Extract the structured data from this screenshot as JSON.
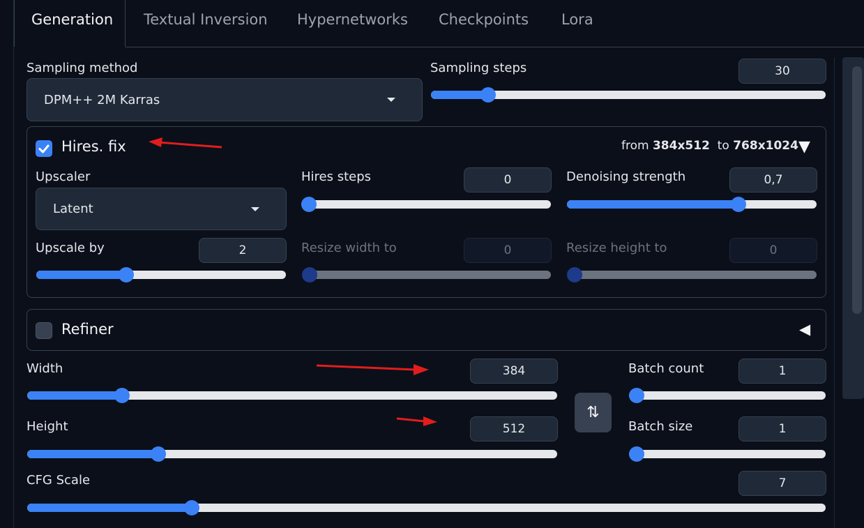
{
  "tabs": [
    "Generation",
    "Textual Inversion",
    "Hypernetworks",
    "Checkpoints",
    "Lora"
  ],
  "sampling": {
    "method_label": "Sampling method",
    "method_value": "DPM++ 2M Karras",
    "steps_label": "Sampling steps",
    "steps_value": "30",
    "steps_fraction": 0.13
  },
  "hires": {
    "label": "Hires. fix",
    "checked": true,
    "from_prefix": "from",
    "from_size": "384x512",
    "to_prefix": "to",
    "to_size": "768x1024",
    "toggle_icon": "▼",
    "upscaler_label": "Upscaler",
    "upscaler_value": "Latent",
    "hires_steps_label": "Hires steps",
    "hires_steps_value": "0",
    "hires_steps_fraction": 0.0,
    "denoise_label": "Denoising strength",
    "denoise_value": "0,7",
    "denoise_fraction": 0.7,
    "upscale_by_label": "Upscale by",
    "upscale_by_value": "2",
    "upscale_by_fraction": 0.35,
    "resize_w_label": "Resize width to",
    "resize_w_value": "0",
    "resize_h_label": "Resize height to",
    "resize_h_value": "0"
  },
  "refiner": {
    "label": "Refiner",
    "checked": false,
    "toggle_icon": "◀"
  },
  "size": {
    "width_label": "Width",
    "width_value": "384",
    "width_fraction": 0.17,
    "height_label": "Height",
    "height_value": "512",
    "height_fraction": 0.24,
    "swap_icon": "⇅"
  },
  "batch": {
    "count_label": "Batch count",
    "count_value": "1",
    "size_label": "Batch size",
    "size_value": "1"
  },
  "cfg": {
    "label": "CFG Scale",
    "value": "7",
    "fraction": 0.2
  },
  "colors": {
    "accent": "#3b82f6",
    "annotation_arrow": "#e11d1d",
    "background": "#0b0f19"
  }
}
